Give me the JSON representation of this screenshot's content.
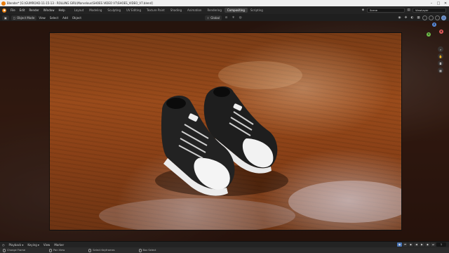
{
  "window": {
    "title": "Blender* [G:\\GUMROAD-11-15-13 - ROLLING GIRL\\Marvelous\\SHOES VIDEO V7\\SHOES_VIDEO_V7.blend]"
  },
  "menu": [
    "File",
    "Edit",
    "Render",
    "Window",
    "Help"
  ],
  "workspaces": [
    "Layout",
    "Modeling",
    "Sculpting",
    "UV Editing",
    "Texture Paint",
    "Shading",
    "Animation",
    "Rendering",
    "Compositing",
    "Scripting"
  ],
  "active_workspace": "Compositing",
  "top_right": {
    "scene_label": "Scene",
    "view_layer_label": "ViewLayer"
  },
  "viewport_header": {
    "mode": "Object Mode",
    "view": "View",
    "select": "Select",
    "add": "Add",
    "object": "Object",
    "orientation": "Global"
  },
  "timeline": {
    "playback": "Playback",
    "keying": "Keying",
    "view": "View",
    "marker": "Marker",
    "current_frame": "1"
  },
  "statusbar": {
    "left": "Change Frame",
    "middle": "Pan View",
    "right1": "Select Keyframes",
    "right2": "Box Select"
  },
  "colors": {
    "accent": "#4772b3",
    "brand": "#e87d0d",
    "active_workspace_bg": "#3d3d3d"
  }
}
